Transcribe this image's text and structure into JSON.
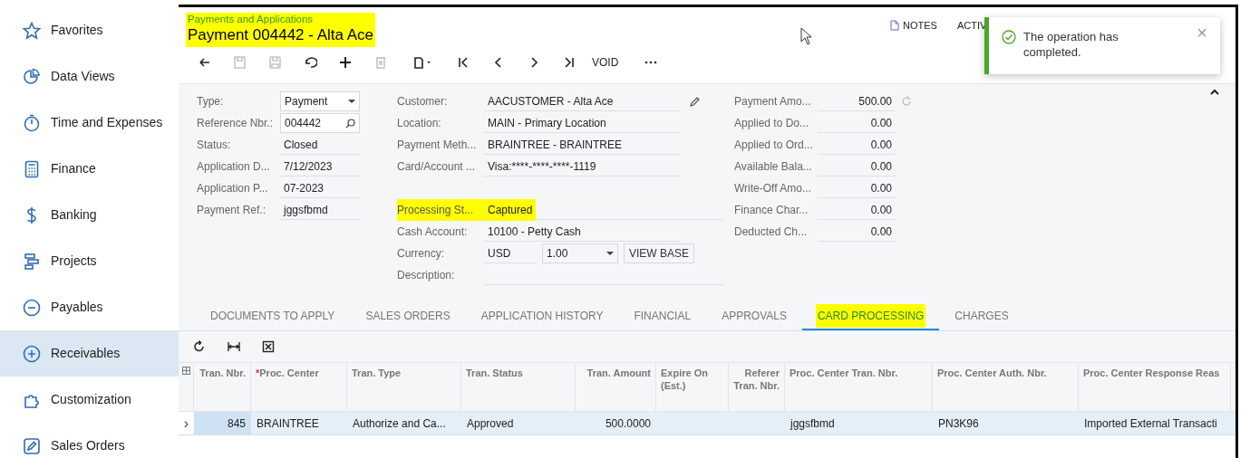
{
  "sidebar": {
    "items": [
      {
        "label": "Favorites",
        "selected": false
      },
      {
        "label": "Data Views",
        "selected": false
      },
      {
        "label": "Time and Expenses",
        "selected": false
      },
      {
        "label": "Finance",
        "selected": false
      },
      {
        "label": "Banking",
        "selected": false
      },
      {
        "label": "Projects",
        "selected": false
      },
      {
        "label": "Payables",
        "selected": false
      },
      {
        "label": "Receivables",
        "selected": true
      },
      {
        "label": "Customization",
        "selected": false
      },
      {
        "label": "Sales Orders",
        "selected": false
      }
    ]
  },
  "header": {
    "breadcrumb": "Payments and Applications",
    "title": "Payment 004442 - Alta Ace",
    "highlighted": true,
    "actions": [
      {
        "label": "NOTES"
      },
      {
        "label": "ACTIV"
      }
    ]
  },
  "toolbar": [
    {
      "kind": "back",
      "disabled": false
    },
    {
      "kind": "save-close",
      "disabled": true
    },
    {
      "kind": "save",
      "disabled": true
    },
    {
      "kind": "undo",
      "disabled": false
    },
    {
      "kind": "add",
      "disabled": false
    },
    {
      "kind": "delete",
      "disabled": true
    },
    {
      "kind": "copy",
      "disabled": false
    },
    {
      "kind": "first",
      "disabled": false
    },
    {
      "kind": "prev",
      "disabled": false
    },
    {
      "kind": "next",
      "disabled": false
    },
    {
      "kind": "last",
      "disabled": false
    },
    {
      "kind": "text",
      "label": "VOID",
      "disabled": false
    },
    {
      "kind": "more",
      "disabled": false
    }
  ],
  "notification": {
    "message": "The operation has completed.",
    "close": "×"
  },
  "form": {
    "left": [
      {
        "label": "Type:",
        "value": "Payment",
        "kind": "dropdown"
      },
      {
        "label": "Reference Nbr.:",
        "value": "004442",
        "kind": "search"
      },
      {
        "label": "Status:",
        "value": "Closed",
        "kind": "text"
      },
      {
        "label": "Application D...",
        "value": "7/12/2023",
        "kind": "text"
      },
      {
        "label": "Application P...",
        "value": "07-2023",
        "kind": "text"
      },
      {
        "label": "Payment Ref.:",
        "value": "jggsfbmd",
        "kind": "text"
      }
    ],
    "middle_top": [
      {
        "label": "Customer:",
        "value": "AACUSTOMER - Alta Ace",
        "kind": "edit",
        "highlighted": false
      },
      {
        "label": "Location:",
        "value": "MAIN - Primary Location",
        "kind": "text",
        "highlighted": false
      },
      {
        "label": "Payment Meth...",
        "value": "BRAINTREE - BRAINTREE",
        "kind": "text",
        "highlighted": false
      },
      {
        "label": "Card/Account ...",
        "value": "Visa:****-****-****-1119",
        "kind": "text",
        "highlighted": false
      }
    ],
    "middle_bottom": [
      {
        "label": "Processing St...",
        "value": "Captured",
        "kind": "text",
        "highlighted": true
      },
      {
        "label": "Cash Account:",
        "value": "10100 - Petty Cash",
        "kind": "text",
        "highlighted": false
      },
      {
        "label": "Currency:",
        "value": "USD",
        "kind": "currency",
        "rate": "1.00",
        "button": "VIEW BASE",
        "highlighted": false
      },
      {
        "label": "Description:",
        "kind": "wide",
        "highlighted": false
      }
    ],
    "right": [
      {
        "label": "Payment Amo...",
        "value": "500.00",
        "kind": "refresh"
      },
      {
        "label": "Applied to Do...",
        "value": "0.00",
        "kind": "text"
      },
      {
        "label": "Applied to Ord...",
        "value": "0.00",
        "kind": "text"
      },
      {
        "label": "Available Bala...",
        "value": "0.00",
        "kind": "text"
      },
      {
        "label": "Write-Off Amo...",
        "value": "0.00",
        "kind": "text"
      },
      {
        "label": "Finance Char...",
        "value": "0.00",
        "kind": "text"
      },
      {
        "label": "Deducted Ch...",
        "value": "0.00",
        "kind": "text"
      }
    ]
  },
  "tabs": [
    {
      "label": "DOCUMENTS TO APPLY",
      "selected": false,
      "highlighted": false
    },
    {
      "label": "SALES ORDERS",
      "selected": false,
      "highlighted": false
    },
    {
      "label": "APPLICATION HISTORY",
      "selected": false,
      "highlighted": false
    },
    {
      "label": "FINANCIAL",
      "selected": false,
      "highlighted": false
    },
    {
      "label": "APPROVALS",
      "selected": false,
      "highlighted": false
    },
    {
      "label": "CARD PROCESSING",
      "selected": true,
      "highlighted": true
    },
    {
      "label": "CHARGES",
      "selected": false,
      "highlighted": false
    }
  ],
  "table": {
    "columns": [
      {
        "label": "Tran. Nbr."
      },
      {
        "label": "Proc. Center",
        "required_mark": "*"
      },
      {
        "label": "Tran. Type"
      },
      {
        "label": "Tran. Status"
      },
      {
        "label": "Tran. Amount"
      },
      {
        "label": "Expire On (Est.)"
      },
      {
        "label": "Referer Tran. Nbr."
      },
      {
        "label": "Proc. Center Tran. Nbr."
      },
      {
        "label": "Proc. Center Auth. Nbr."
      },
      {
        "label": "Proc. Center Response Reas"
      }
    ],
    "rows": [
      {
        "selected": true,
        "expand": "›",
        "cells": [
          "845",
          "BRAINTREE",
          "Authorize and Ca...",
          "Approved",
          "500.0000",
          null,
          null,
          "jggsfbmd",
          "PN3K96",
          "Imported External Transacti"
        ]
      }
    ]
  }
}
